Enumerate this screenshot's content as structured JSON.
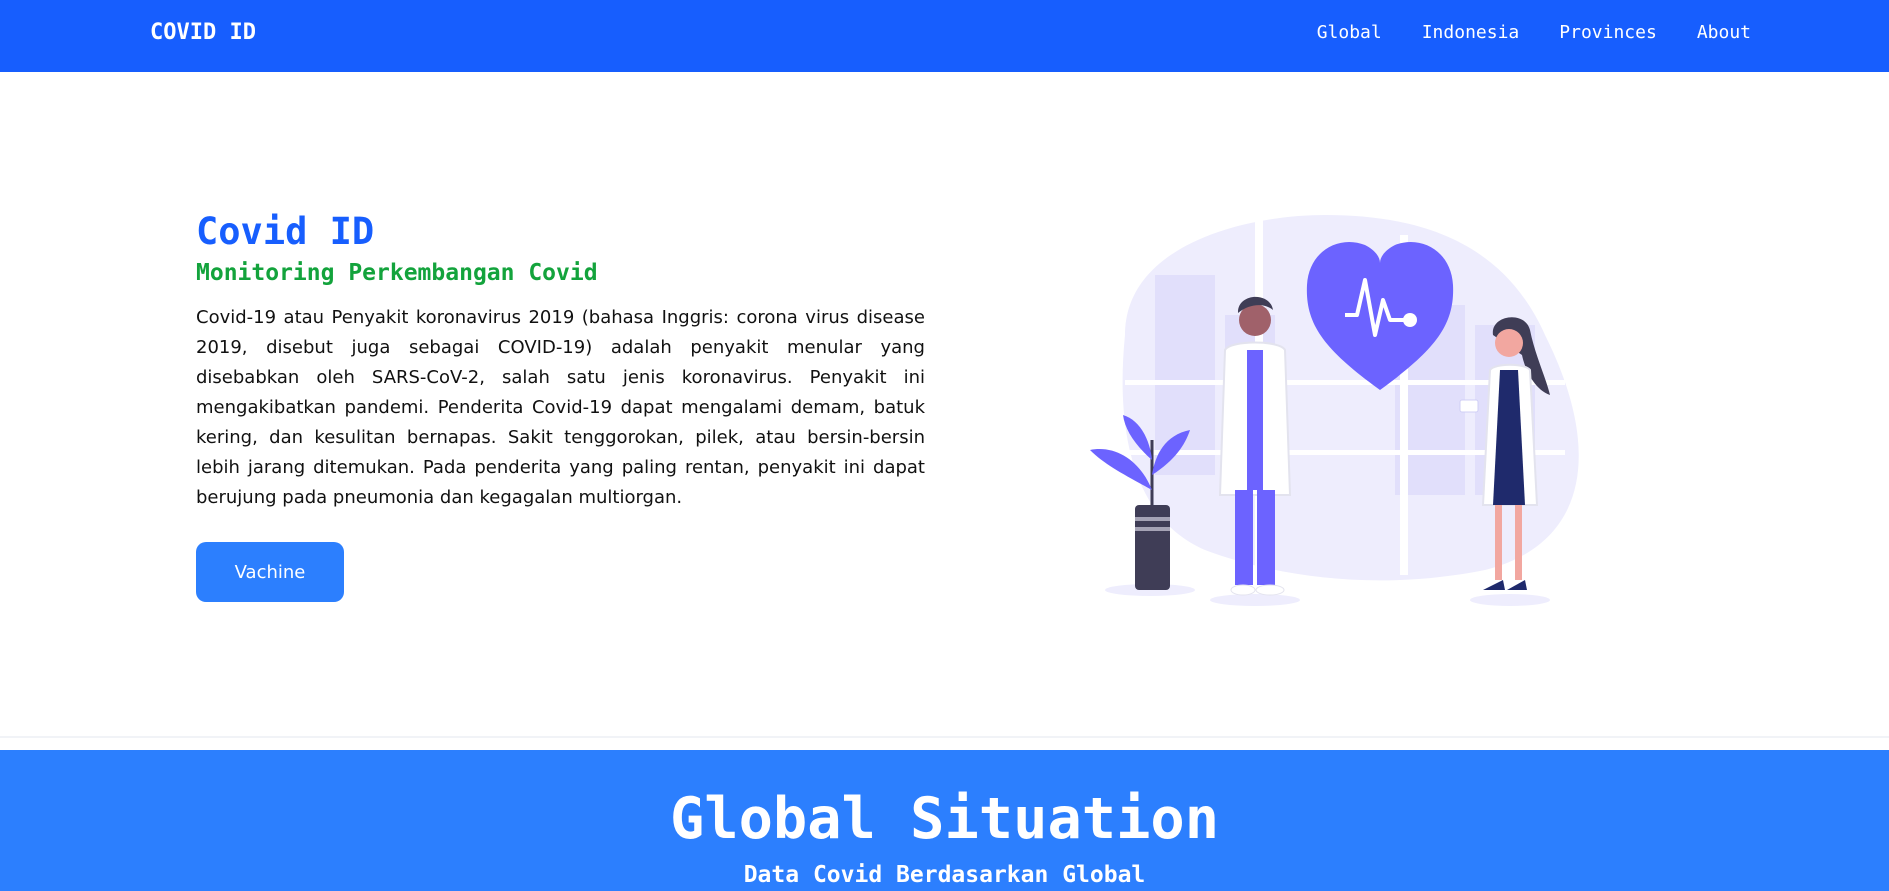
{
  "nav": {
    "brand": "COVID ID",
    "links": [
      {
        "label": "Global"
      },
      {
        "label": "Indonesia"
      },
      {
        "label": "Provinces"
      },
      {
        "label": "About"
      }
    ]
  },
  "hero": {
    "title": "Covid ID",
    "subtitle": "Monitoring Perkembangan Covid",
    "description": "Covid-19 atau Penyakit koronavirus 2019 (bahasa Inggris: corona virus disease 2019, disebut juga sebagai COVID-19) adalah penyakit menular yang disebabkan oleh SARS-CoV-2, salah satu jenis koronavirus. Penyakit ini mengakibatkan pandemi. Penderita Covid-19 dapat mengalami demam, batuk kering, dan kesulitan bernapas. Sakit tenggorokan, pilek, atau bersin-bersin lebih jarang ditemukan. Pada penderita yang paling rentan, penyakit ini dapat berujung pada pneumonia dan kegagalan multiorgan.",
    "button_label": "Vachine",
    "illustration_icon": "doctors-heart-illustration"
  },
  "global": {
    "title": "Global Situation",
    "subtitle": "Data Covid Berdasarkan Global"
  },
  "colors": {
    "navbar": "#175efe",
    "accent_title": "#175efe",
    "accent_subtitle": "#13a33c",
    "button": "#2c7ffe",
    "section": "#2c7ffe",
    "illustration": "#6c63ff"
  }
}
